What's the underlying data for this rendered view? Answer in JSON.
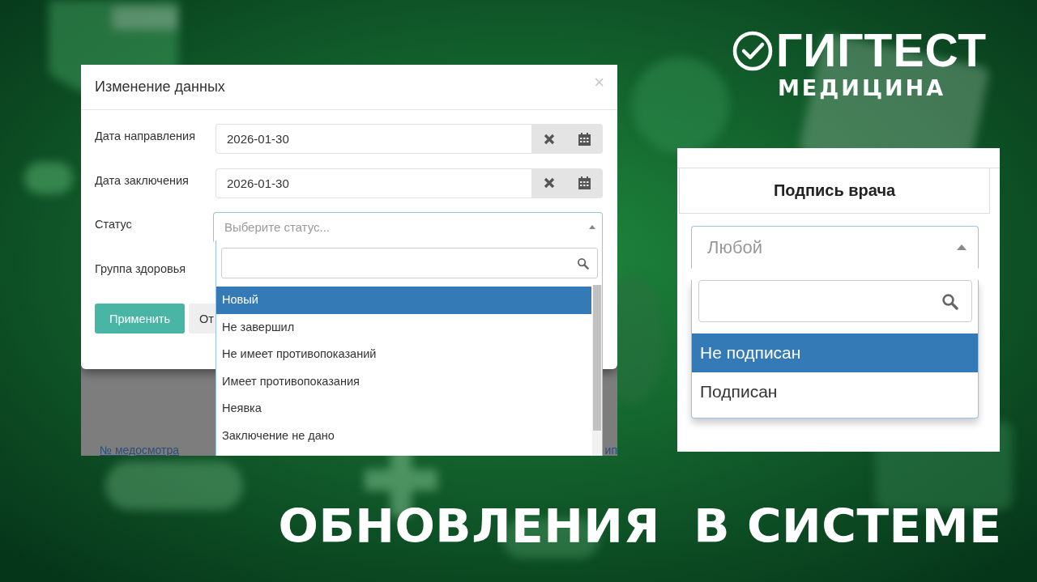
{
  "logo": {
    "name": "ГИГТЕСТ",
    "subtitle": "МЕДИЦИНА"
  },
  "edit_dialog": {
    "title": "Изменение данных",
    "close": "×",
    "fields": [
      {
        "kind": "date",
        "label": "Дата направления",
        "value": "2026-01-30"
      },
      {
        "kind": "date",
        "label": "Дата заключения",
        "value": "2026-01-30"
      },
      {
        "kind": "select",
        "label": "Статус",
        "placeholder": "Выберите статус...",
        "expanded": true
      },
      {
        "kind": "covered",
        "label": "Группа здоровья"
      }
    ],
    "buttons": [
      {
        "kind": "primary",
        "label": "Применить"
      },
      {
        "kind": "default",
        "label": "От"
      }
    ],
    "dropdown": {
      "options": [
        {
          "label": "Новый",
          "selected": true
        },
        {
          "label": "Не завершил",
          "selected": false
        },
        {
          "label": "Не имеет противопоказаний",
          "selected": false
        },
        {
          "label": "Имеет противопоказания",
          "selected": false
        },
        {
          "label": "Неявка",
          "selected": false
        },
        {
          "label": "Заключение не дано",
          "selected": false
        }
      ]
    },
    "background_table": {
      "column_1": "№ медосмотра",
      "column_2": "ип"
    }
  },
  "signature_filter": {
    "header": "Подпись врача",
    "select": {
      "placeholder": "Любой",
      "expanded": true
    },
    "options": [
      {
        "label": "Не подписан",
        "selected": true
      },
      {
        "label": "Подписан",
        "selected": false
      }
    ]
  },
  "headline": "ОБНОВЛЕНИЯ  В СИСТЕМЕ"
}
